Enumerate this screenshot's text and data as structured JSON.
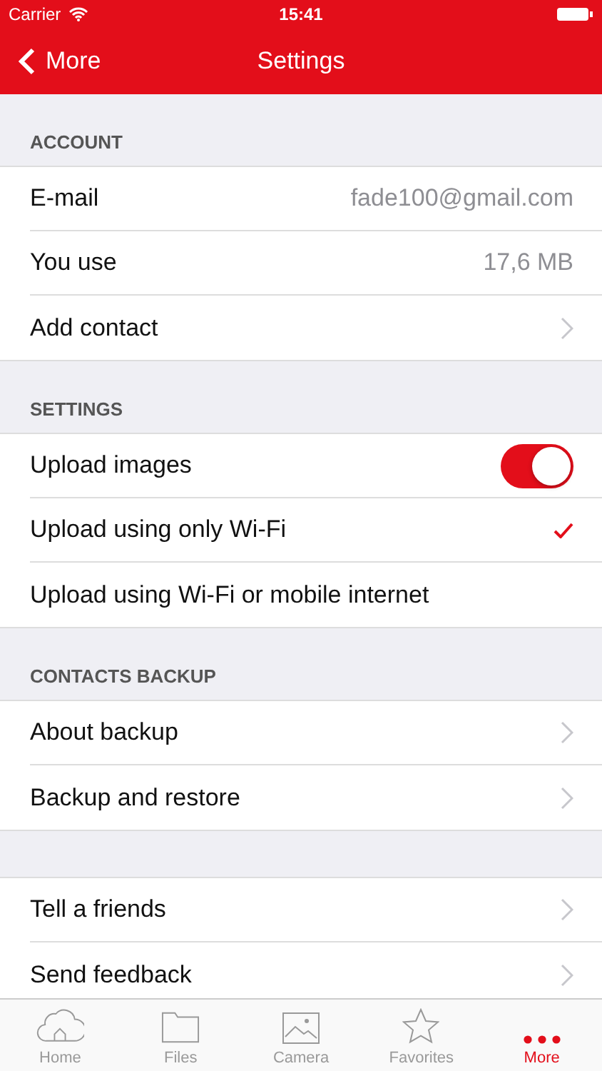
{
  "status_bar": {
    "carrier": "Carrier",
    "time": "15:41"
  },
  "nav": {
    "back": "More",
    "title": "Settings"
  },
  "sections": [
    {
      "header": "ACCOUNT",
      "rows": [
        {
          "kind": "value",
          "label": "E-mail",
          "value": "fade100@gmail.com"
        },
        {
          "kind": "value",
          "label": "You use",
          "value": "17,6 MB"
        },
        {
          "kind": "link",
          "label": "Add contact"
        }
      ]
    },
    {
      "header": "SETTINGS",
      "rows": [
        {
          "kind": "toggle",
          "label": "Upload images",
          "on": true
        },
        {
          "kind": "option",
          "label": "Upload using only Wi-Fi",
          "selected": true
        },
        {
          "kind": "option",
          "label": "Upload using Wi-Fi or mobile internet",
          "selected": false
        }
      ]
    },
    {
      "header": "CONTACTS BACKUP",
      "rows": [
        {
          "kind": "link",
          "label": "About backup"
        },
        {
          "kind": "link",
          "label": "Backup and restore"
        }
      ]
    },
    {
      "rows": [
        {
          "kind": "link",
          "label": "Tell a friends"
        },
        {
          "kind": "link",
          "label": "Send feedback"
        }
      ]
    }
  ],
  "tab_bar": [
    {
      "label": "Home",
      "kind": "cloud",
      "selected": false
    },
    {
      "label": "Files",
      "kind": "folder",
      "selected": false
    },
    {
      "label": "Camera",
      "kind": "image",
      "selected": false
    },
    {
      "label": "Favorites",
      "kind": "star",
      "selected": false
    },
    {
      "label": "More",
      "kind": "dots",
      "selected": true
    }
  ]
}
